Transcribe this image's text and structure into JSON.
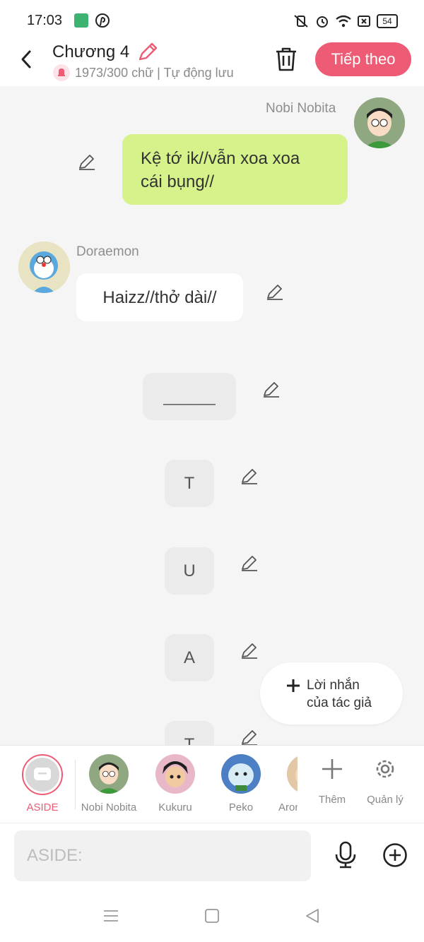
{
  "status_bar": {
    "time": "17:03",
    "battery": "54",
    "icons": [
      "app-green-icon",
      "pinterest-icon",
      "mute-vibrate-icon",
      "alarm-icon",
      "wifi-icon",
      "sim-icon",
      "battery-icon"
    ]
  },
  "header": {
    "title": "Chương 4",
    "subtitle": "1973/300 chữ | Tự động lưu",
    "next_label": "Tiếp theo"
  },
  "messages": [
    {
      "speaker": "Nobi Nobita",
      "side": "right",
      "text_line1": "Kệ tớ ik//vẫn xoa xoa",
      "text_line2": "cái bụng//"
    },
    {
      "speaker": "Doraemon",
      "side": "left",
      "text": "Haizz//thở dài//"
    },
    {
      "aside": "______"
    },
    {
      "aside": "T"
    },
    {
      "aside": "U"
    },
    {
      "aside": "A"
    },
    {
      "aside": "T"
    }
  ],
  "author_note": {
    "line1": "Lời nhắn",
    "line2": "của tác giả"
  },
  "characters": [
    {
      "label": "ASIDE"
    },
    {
      "label": "Nobi Nobita"
    },
    {
      "label": "Kukuru"
    },
    {
      "label": "Peko"
    },
    {
      "label": "Aron"
    }
  ],
  "actions": {
    "add_label": "Thêm",
    "manage_label": "Quản lý"
  },
  "composer": {
    "placeholder": "ASIDE:"
  },
  "colors": {
    "accent": "#ee5b74",
    "green_bubble": "#d6f28a",
    "background": "#f5f5f5"
  }
}
